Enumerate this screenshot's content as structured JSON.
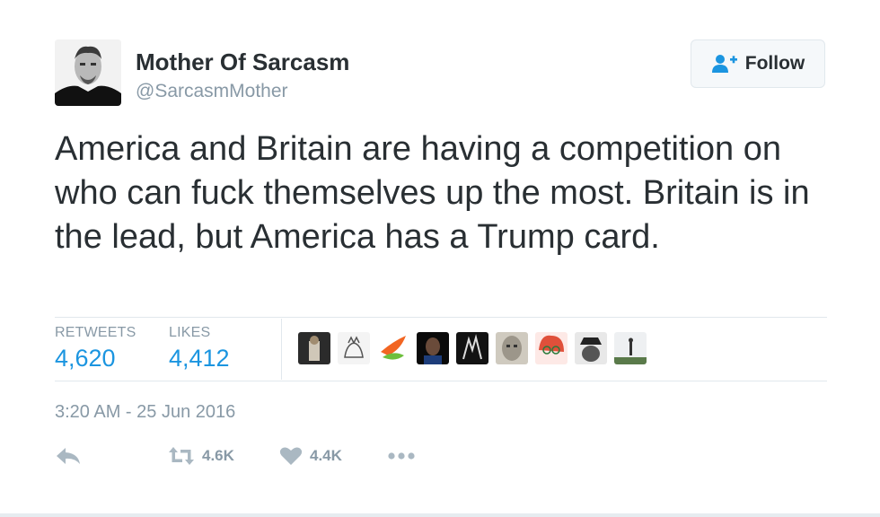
{
  "user": {
    "display_name": "Mother Of Sarcasm",
    "handle": "@SarcasmMother",
    "avatar_icon": "profile-photo"
  },
  "follow_button": {
    "label": "Follow",
    "icon": "follow-user-plus-icon"
  },
  "tweet": {
    "text": "America and Britain are having a competition on who can fuck themselves up the most. Britain is in the lead, but America has a Trump card."
  },
  "stats": {
    "retweets_label": "RETWEETS",
    "retweets_value": "4,620",
    "likes_label": "LIKES",
    "likes_value": "4,412"
  },
  "likers": [
    "liker-avatar-1",
    "liker-avatar-2",
    "liker-avatar-3",
    "liker-avatar-4",
    "liker-avatar-5",
    "liker-avatar-6",
    "liker-avatar-7",
    "liker-avatar-8",
    "liker-avatar-9"
  ],
  "timestamp": "3:20 AM - 25 Jun 2016",
  "actions": {
    "reply_icon": "reply-icon",
    "retweet_count": "4.6K",
    "like_count": "4.4K",
    "more_icon": "more-icon"
  },
  "colors": {
    "link_blue": "#1b95e0",
    "text_dark": "#292f33",
    "text_gray": "#8899a6",
    "border": "#e1e8ed"
  }
}
